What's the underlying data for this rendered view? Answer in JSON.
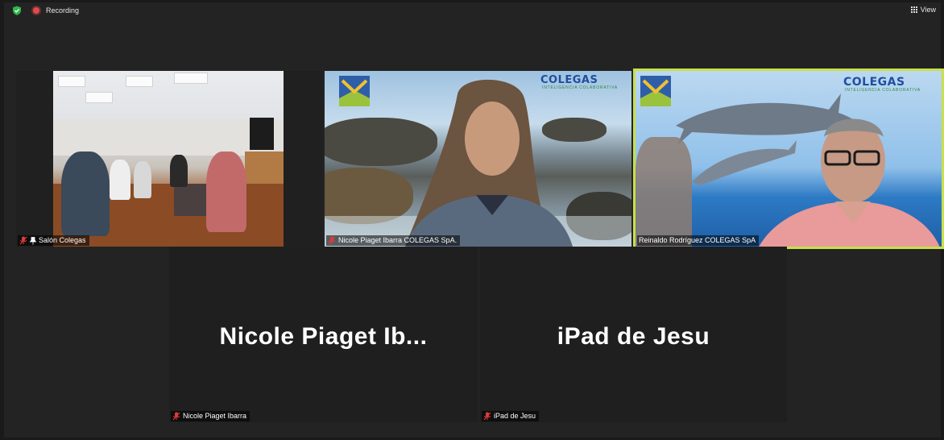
{
  "topbar": {
    "recording_label": "Recording",
    "view_label": "View"
  },
  "tiles": [
    {
      "label": "Salón Colegas"
    },
    {
      "label": "Nicole Piaget Ibarra COLEGAS SpA."
    },
    {
      "label": "Reinaldo Rodríguez  COLEGAS SpA"
    },
    {
      "label": "Nicole Piaget Ibarra",
      "display_name": "Nicole  Piaget  Ib..."
    },
    {
      "label": "iPad de Jesu",
      "display_name": "iPad de Jesu"
    }
  ],
  "backgrounds": {
    "brand_text": "COLEGAS",
    "brand_subtext": "INTELIGENCIA COLABORATIVA"
  },
  "colors": {
    "active_speaker_border": "#c7e04b",
    "recording_dot": "#e04a4a",
    "shield": "#2eb84a",
    "mic_muted": "#e03a3a"
  }
}
